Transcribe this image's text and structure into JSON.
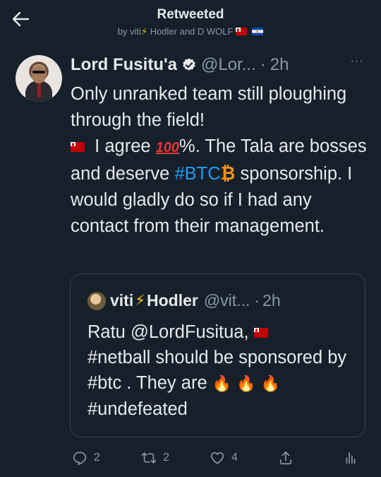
{
  "header": {
    "title": "Retweeted",
    "by_prefix": "by viti",
    "by_mid": "Hodler and D WOLF",
    "bolt": "⚡"
  },
  "tweet": {
    "name": "Lord Fusitu'a",
    "handle": "@Lor...",
    "sep": "·",
    "time": "2h",
    "more": "···",
    "text_1": "Only unranked team still ploughing through the field!",
    "text_2": "I agree",
    "text_hundred": "100",
    "text_3": "%. The Tala are bosses and deserve",
    "hashtag_btc": "#BTC",
    "btc_symbol": "₿",
    "text_4": "sponsorship. I would gladly do so if I had any contact from their management."
  },
  "quote": {
    "name": "viti",
    "bolt": "⚡",
    "name_2": "Hodler",
    "handle": "@vit...",
    "sep": "·",
    "time": "2h",
    "text_1": "Ratu @LordFusitua,",
    "text_2": "#netball should be sponsored by #btc . They are",
    "fire": "🔥",
    "hashtag_undefeated": "#undefeated"
  },
  "actions": {
    "reply_count": "2",
    "retweet_count": "2",
    "like_count": "4"
  },
  "colors": {
    "background": "#15202b",
    "accent": "#1d9bf0",
    "muted": "#8b98a5"
  }
}
